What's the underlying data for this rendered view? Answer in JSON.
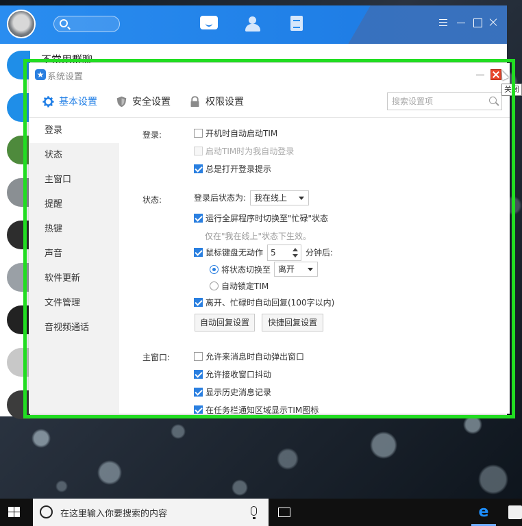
{
  "tim": {
    "list_title": "不常用群聊"
  },
  "dialog": {
    "title": "系统设置",
    "tooltip": "关闭",
    "tabs": [
      {
        "label": "基本设置"
      },
      {
        "label": "安全设置"
      },
      {
        "label": "权限设置"
      }
    ],
    "search_placeholder": "搜索设置项",
    "sidebar": [
      "登录",
      "状态",
      "主窗口",
      "提醒",
      "热键",
      "声音",
      "软件更新",
      "文件管理",
      "音视频通话"
    ],
    "login": {
      "label": "登录:",
      "auto_start": "开机时自动启动TIM",
      "auto_login": "启动TIM时为我自动登录",
      "open_prompt": "总是打开登录提示"
    },
    "status": {
      "label": "状态:",
      "after_login_label": "登录后状态为:",
      "after_login_value": "我在线上",
      "fullscreen_busy": "运行全屏程序时切换至\"忙碌\"状态",
      "fullscreen_hint": "仅在\"我在线上\"状态下生效。",
      "idle_label": "鼠标键盘无动作",
      "idle_minutes": "5",
      "idle_suffix": "分钟后:",
      "switch_to_label": "将状态切换至",
      "switch_to_value": "离开",
      "auto_lock": "自动锁定TIM",
      "auto_reply": "离开、忙碌时自动回复(100字以内)",
      "auto_reply_btn": "自动回复设置",
      "quick_reply_btn": "快捷回复设置"
    },
    "main_window": {
      "label": "主窗口:",
      "popup": "允许来消息时自动弹出窗口",
      "shake": "允许接收窗口抖动",
      "history": "显示历史消息记录",
      "tray": "在任务栏通知区域显示TIM图标"
    }
  },
  "taskbar": {
    "search_placeholder": "在这里输入你要搜索的内容"
  },
  "colors": {
    "accent": "#2a7fe0",
    "tim_header": "#1f7ee6",
    "focus_frame": "#22dd22",
    "close_button": "#e8472c"
  }
}
